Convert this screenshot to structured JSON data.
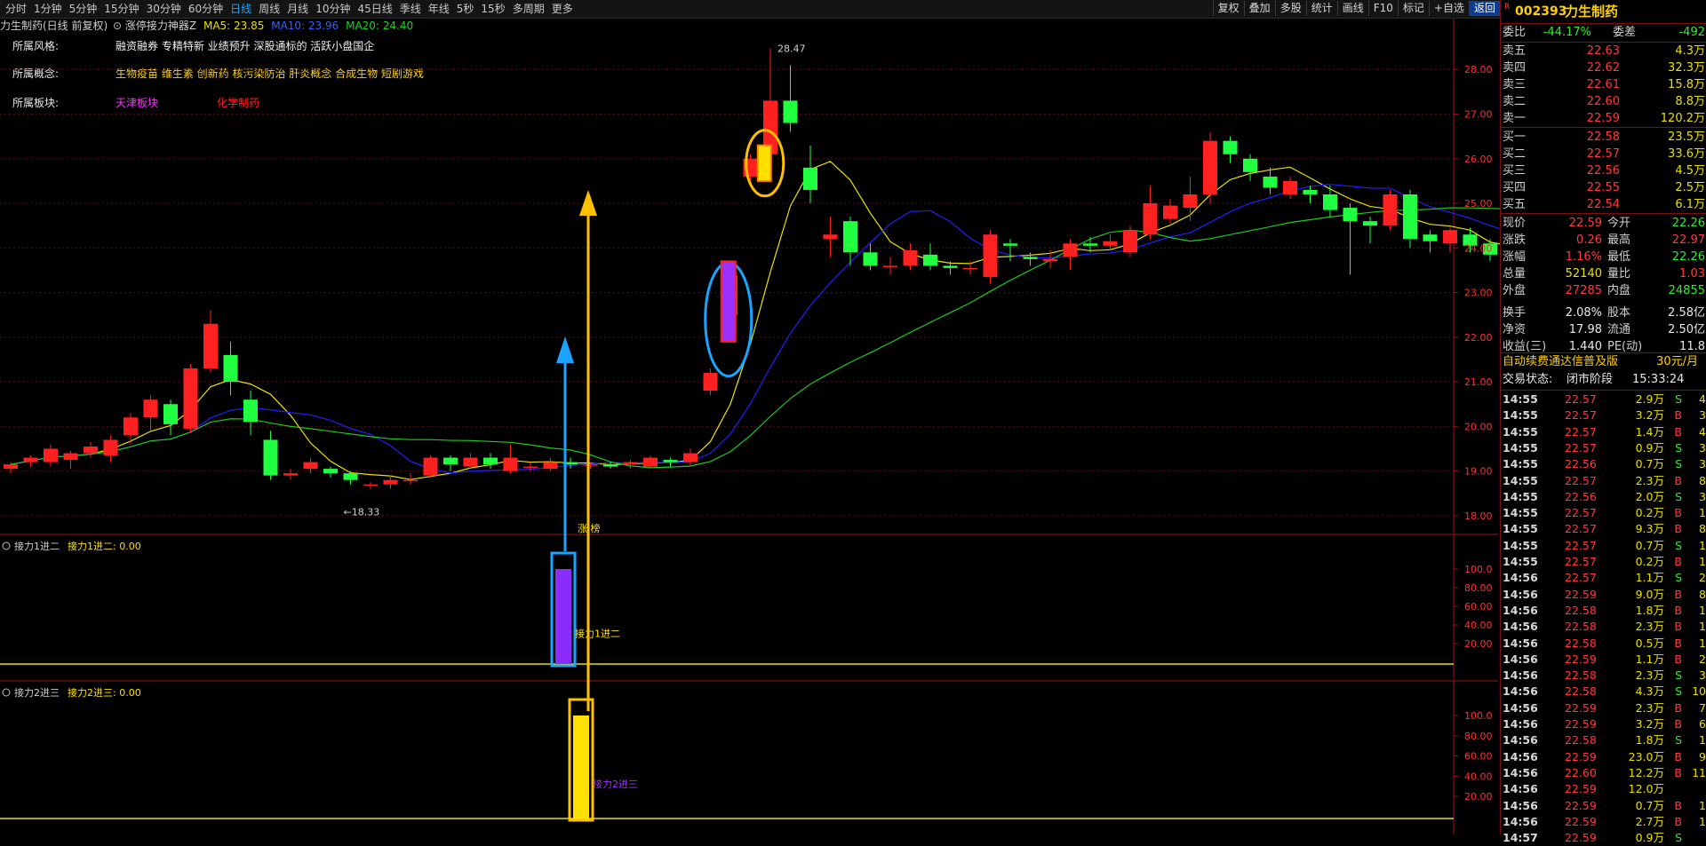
{
  "toolbar": {
    "periods": [
      "分时",
      "1分钟",
      "5分钟",
      "15分钟",
      "30分钟",
      "60分钟",
      "日线",
      "周线",
      "月线",
      "10分钟",
      "45日线",
      "季线",
      "年线",
      "5秒",
      "15秒",
      "多周期",
      "更多"
    ],
    "active_period": "日线",
    "tools": [
      "复权",
      "叠加",
      "多股",
      "统计",
      "画线",
      "F10",
      "标记",
      "+自选",
      "返回"
    ]
  },
  "chart_header": {
    "stock": "力生制药(日线 前复权)",
    "indicator": "涨停接力神器Z",
    "ma5": "MA5: 23.85",
    "ma10": "MA10: 23.96",
    "ma20": "MA20: 24.40"
  },
  "info": {
    "style_label": "所属风格:",
    "style_value": "融资融券 专精特新 业绩预升 深股通标的 活跃小盘国企",
    "concept_label": "所属概念:",
    "concept_value": "生物疫苗 维生素 创新药 核污染防治 肝炎概念 合成生物 短剧游戏",
    "sector_label": "所属板块:",
    "sector_value1": "天津板块",
    "sector_value2": "化学制药"
  },
  "price_axis": [
    "28.00",
    "27.00",
    "26.00",
    "25.00",
    "24.00",
    "23.00",
    "22.00",
    "21.00",
    "20.00",
    "19.00",
    "18.00"
  ],
  "annotations": {
    "high": "28.47",
    "low": "18.33",
    "limit_up": "涨 榜"
  },
  "panel1": {
    "title": "接力1进二",
    "value_label": "接力1进二: 0.00",
    "signal": "接力1进二",
    "axis": [
      "100.0",
      "80.00",
      "60.00",
      "40.00",
      "20.00"
    ]
  },
  "panel2": {
    "title": "接力2进三",
    "value_label": "接力2进三: 0.00",
    "signal": "接力2进三",
    "axis": [
      "100.0",
      "80.00",
      "60.00",
      "40.00",
      "20.00"
    ]
  },
  "colors": {
    "up": "#ff2020",
    "down": "#20ff40",
    "ma5": "#e8e000",
    "ma10": "#2020ff",
    "ma20": "#20c820",
    "accent_blue": "#1aa3ff",
    "accent_gold": "#ffc000"
  },
  "quote": {
    "code": "002393",
    "name": "力生制药",
    "ratio_label": "委比",
    "ratio": "-44.17%",
    "diff_label": "委差",
    "diff": "-492",
    "asks": [
      {
        "label": "卖五",
        "price": "22.63",
        "vol": "4.3万"
      },
      {
        "label": "卖四",
        "price": "22.62",
        "vol": "32.3万"
      },
      {
        "label": "卖三",
        "price": "22.61",
        "vol": "15.8万"
      },
      {
        "label": "卖二",
        "price": "22.60",
        "vol": "8.8万"
      },
      {
        "label": "卖一",
        "price": "22.59",
        "vol": "120.2万"
      }
    ],
    "bids": [
      {
        "label": "买一",
        "price": "22.58",
        "vol": "23.5万"
      },
      {
        "label": "买二",
        "price": "22.57",
        "vol": "33.6万"
      },
      {
        "label": "买三",
        "price": "22.56",
        "vol": "4.5万"
      },
      {
        "label": "买四",
        "price": "22.55",
        "vol": "2.5万"
      },
      {
        "label": "买五",
        "price": "22.54",
        "vol": "6.1万"
      }
    ],
    "details": [
      {
        "l1": "现价",
        "v1": "22.59",
        "c1": "red",
        "l2": "今开",
        "v2": "22.26",
        "c2": "green"
      },
      {
        "l1": "涨跌",
        "v1": "0.26",
        "c1": "red",
        "l2": "最高",
        "v2": "22.97",
        "c2": "red"
      },
      {
        "l1": "涨幅",
        "v1": "1.16%",
        "c1": "red",
        "l2": "最低",
        "v2": "22.26",
        "c2": "green"
      },
      {
        "l1": "总量",
        "v1": "52140",
        "c1": "yellow",
        "l2": "量比",
        "v2": "1.03",
        "c2": "red"
      },
      {
        "l1": "外盘",
        "v1": "27285",
        "c1": "red",
        "l2": "内盘",
        "v2": "24855",
        "c2": "green"
      },
      {
        "l1": "换手",
        "v1": "2.08%",
        "c1": "white",
        "l2": "股本",
        "v2": "2.58亿",
        "c2": "white"
      },
      {
        "l1": "净资",
        "v1": "17.98",
        "c1": "white",
        "l2": "流通",
        "v2": "2.50亿",
        "c2": "white"
      },
      {
        "l1": "收益(三)",
        "v1": "1.440",
        "c1": "white",
        "l2": "PE(动)",
        "v2": "11.8",
        "c2": "white"
      }
    ],
    "promo": "自动续费通达信普及版",
    "promo_price": "30元/月",
    "trade_status_label": "交易状态:",
    "trade_status": "闭市阶段",
    "trade_time": "15:33:24"
  },
  "ticks": [
    {
      "t": "14:55",
      "p": "22.57",
      "v": "2.9万",
      "s": "S",
      "n": "4"
    },
    {
      "t": "14:55",
      "p": "22.57",
      "v": "3.2万",
      "s": "B",
      "n": "3"
    },
    {
      "t": "14:55",
      "p": "22.57",
      "v": "1.4万",
      "s": "B",
      "n": "4"
    },
    {
      "t": "14:55",
      "p": "22.57",
      "v": "0.9万",
      "s": "S",
      "n": "3"
    },
    {
      "t": "14:55",
      "p": "22.56",
      "v": "0.7万",
      "s": "S",
      "n": "3"
    },
    {
      "t": "14:55",
      "p": "22.57",
      "v": "2.3万",
      "s": "B",
      "n": "8"
    },
    {
      "t": "14:55",
      "p": "22.56",
      "v": "2.0万",
      "s": "S",
      "n": "3"
    },
    {
      "t": "14:55",
      "p": "22.57",
      "v": "0.2万",
      "s": "B",
      "n": "1"
    },
    {
      "t": "14:55",
      "p": "22.57",
      "v": "9.3万",
      "s": "B",
      "n": "8"
    },
    {
      "t": "14:55",
      "p": "22.57",
      "v": "0.7万",
      "s": "S",
      "n": "1"
    },
    {
      "t": "14:55",
      "p": "22.57",
      "v": "0.2万",
      "s": "B",
      "n": "1"
    },
    {
      "t": "14:56",
      "p": "22.57",
      "v": "1.1万",
      "s": "S",
      "n": "2"
    },
    {
      "t": "14:56",
      "p": "22.59",
      "v": "9.0万",
      "s": "B",
      "n": "8"
    },
    {
      "t": "14:56",
      "p": "22.58",
      "v": "1.8万",
      "s": "B",
      "n": "1"
    },
    {
      "t": "14:56",
      "p": "22.58",
      "v": "2.3万",
      "s": "B",
      "n": "1"
    },
    {
      "t": "14:56",
      "p": "22.58",
      "v": "0.5万",
      "s": "B",
      "n": "1"
    },
    {
      "t": "14:56",
      "p": "22.59",
      "v": "1.1万",
      "s": "B",
      "n": "2"
    },
    {
      "t": "14:56",
      "p": "22.58",
      "v": "2.3万",
      "s": "S",
      "n": "3"
    },
    {
      "t": "14:56",
      "p": "22.58",
      "v": "4.3万",
      "s": "S",
      "n": "10"
    },
    {
      "t": "14:56",
      "p": "22.59",
      "v": "2.3万",
      "s": "B",
      "n": "7"
    },
    {
      "t": "14:56",
      "p": "22.59",
      "v": "3.2万",
      "s": "B",
      "n": "6"
    },
    {
      "t": "14:56",
      "p": "22.58",
      "v": "1.8万",
      "s": "S",
      "n": "1"
    },
    {
      "t": "14:56",
      "p": "22.59",
      "v": "23.0万",
      "s": "B",
      "n": "9"
    },
    {
      "t": "14:56",
      "p": "22.60",
      "v": "12.2万",
      "s": "B",
      "n": "11"
    },
    {
      "t": "14:56",
      "p": "22.59",
      "v": "12.0万",
      "s": "",
      "n": ""
    },
    {
      "t": "14:56",
      "p": "22.59",
      "v": "0.7万",
      "s": "B",
      "n": "1"
    },
    {
      "t": "14:56",
      "p": "22.59",
      "v": "2.7万",
      "s": "B",
      "n": "1"
    },
    {
      "t": "14:57",
      "p": "22.59",
      "v": "0.9万",
      "s": "S",
      "n": ""
    }
  ],
  "chart_data": {
    "type": "candlestick",
    "ohlc": [
      [
        19.05,
        19.15,
        18.95,
        19.2
      ],
      [
        19.2,
        19.3,
        19.1,
        19.35
      ],
      [
        19.2,
        19.5,
        19.1,
        19.6
      ],
      [
        19.25,
        19.4,
        19.05,
        19.45
      ],
      [
        19.4,
        19.55,
        19.3,
        19.65
      ],
      [
        19.35,
        19.7,
        19.2,
        19.8
      ],
      [
        19.8,
        20.2,
        19.6,
        20.3
      ],
      [
        20.2,
        20.6,
        19.9,
        20.7
      ],
      [
        20.5,
        20.05,
        19.8,
        20.6
      ],
      [
        19.95,
        21.3,
        19.85,
        21.4
      ],
      [
        21.3,
        22.3,
        21.2,
        22.6
      ],
      [
        21.6,
        21.0,
        20.7,
        21.9
      ],
      [
        20.6,
        20.1,
        19.8,
        20.8
      ],
      [
        19.7,
        18.9,
        18.8,
        19.9
      ],
      [
        18.9,
        18.95,
        18.8,
        19.05
      ],
      [
        19.05,
        19.2,
        18.95,
        19.3
      ],
      [
        19.05,
        18.95,
        18.85,
        19.1
      ],
      [
        18.95,
        18.8,
        18.7,
        19.0
      ],
      [
        18.7,
        18.7,
        18.6,
        18.75
      ],
      [
        18.7,
        18.8,
        18.6,
        18.9
      ],
      [
        18.8,
        18.8,
        18.7,
        18.95
      ],
      [
        18.9,
        19.3,
        18.85,
        19.35
      ],
      [
        19.3,
        19.15,
        19.0,
        19.35
      ],
      [
        19.1,
        19.3,
        19.05,
        19.4
      ],
      [
        19.3,
        19.15,
        19.05,
        19.4
      ],
      [
        19.0,
        19.3,
        18.95,
        19.6
      ],
      [
        19.1,
        19.1,
        19.0,
        19.2
      ],
      [
        19.05,
        19.2,
        19.0,
        19.3
      ],
      [
        19.2,
        19.15,
        19.05,
        19.3
      ],
      [
        19.15,
        19.15,
        19.05,
        19.2
      ],
      [
        19.15,
        19.1,
        19.05,
        19.2
      ],
      [
        19.15,
        19.2,
        19.05,
        19.25
      ],
      [
        19.1,
        19.3,
        19.05,
        19.35
      ],
      [
        19.25,
        19.2,
        19.1,
        19.3
      ],
      [
        19.2,
        19.4,
        19.1,
        19.5
      ],
      [
        20.8,
        21.2,
        20.7,
        21.3
      ],
      [
        22.5,
        23.4,
        22.3,
        23.6
      ],
      [
        25.6,
        26.0,
        25.5,
        26.1
      ],
      [
        26.1,
        27.3,
        25.9,
        28.47
      ],
      [
        27.3,
        26.8,
        26.6,
        28.1
      ],
      [
        25.8,
        25.3,
        25.0,
        26.3
      ],
      [
        24.2,
        24.3,
        23.8,
        24.7
      ],
      [
        24.6,
        23.9,
        23.6,
        24.7
      ],
      [
        23.9,
        23.6,
        23.5,
        24.1
      ],
      [
        23.6,
        23.6,
        23.4,
        23.8
      ],
      [
        23.6,
        23.95,
        23.5,
        24.1
      ],
      [
        23.85,
        23.6,
        23.5,
        24.1
      ],
      [
        23.6,
        23.55,
        23.4,
        23.7
      ],
      [
        23.55,
        23.55,
        23.4,
        23.7
      ],
      [
        23.35,
        24.3,
        23.2,
        24.4
      ],
      [
        24.1,
        24.05,
        23.7,
        24.2
      ],
      [
        23.8,
        23.75,
        23.6,
        23.9
      ],
      [
        23.7,
        23.75,
        23.55,
        23.95
      ],
      [
        23.8,
        24.1,
        23.5,
        24.2
      ],
      [
        24.1,
        24.05,
        23.9,
        24.25
      ],
      [
        24.05,
        24.15,
        23.95,
        24.3
      ],
      [
        23.9,
        24.4,
        23.8,
        24.5
      ],
      [
        24.3,
        25.0,
        24.2,
        25.4
      ],
      [
        24.65,
        24.95,
        24.55,
        25.1
      ],
      [
        24.9,
        25.2,
        24.6,
        25.6
      ],
      [
        25.2,
        26.4,
        25.0,
        26.6
      ],
      [
        26.4,
        26.1,
        25.9,
        26.5
      ],
      [
        26.0,
        25.7,
        25.5,
        26.1
      ],
      [
        25.6,
        25.35,
        25.2,
        25.8
      ],
      [
        25.2,
        25.5,
        25.1,
        25.6
      ],
      [
        25.3,
        25.2,
        25.0,
        25.4
      ],
      [
        25.2,
        24.85,
        24.7,
        25.4
      ],
      [
        24.9,
        24.6,
        23.4,
        25.0
      ],
      [
        24.6,
        24.5,
        24.1,
        24.7
      ],
      [
        24.5,
        25.2,
        24.4,
        25.3
      ],
      [
        25.2,
        24.2,
        24.0,
        25.3
      ],
      [
        24.3,
        24.15,
        23.9,
        24.4
      ],
      [
        24.1,
        24.4,
        23.9,
        24.45
      ],
      [
        24.3,
        24.05,
        23.9,
        24.45
      ],
      [
        24.1,
        23.85,
        23.7,
        24.2
      ],
      [
        23.8,
        23.8,
        23.7,
        23.9
      ],
      [
        23.7,
        23.65,
        23.1,
        23.8
      ],
      [
        23.95,
        23.8,
        23.5,
        24.15
      ],
      [
        23.9,
        23.95,
        23.7,
        24.15
      ],
      [
        24.05,
        23.8,
        23.6,
        24.1
      ]
    ],
    "price_range": [
      17.6,
      28.9
    ],
    "panel1_signal": {
      "bar": 35,
      "value": 100.0
    },
    "panel2_signal": {
      "bar": 36,
      "value": 100.0
    }
  }
}
